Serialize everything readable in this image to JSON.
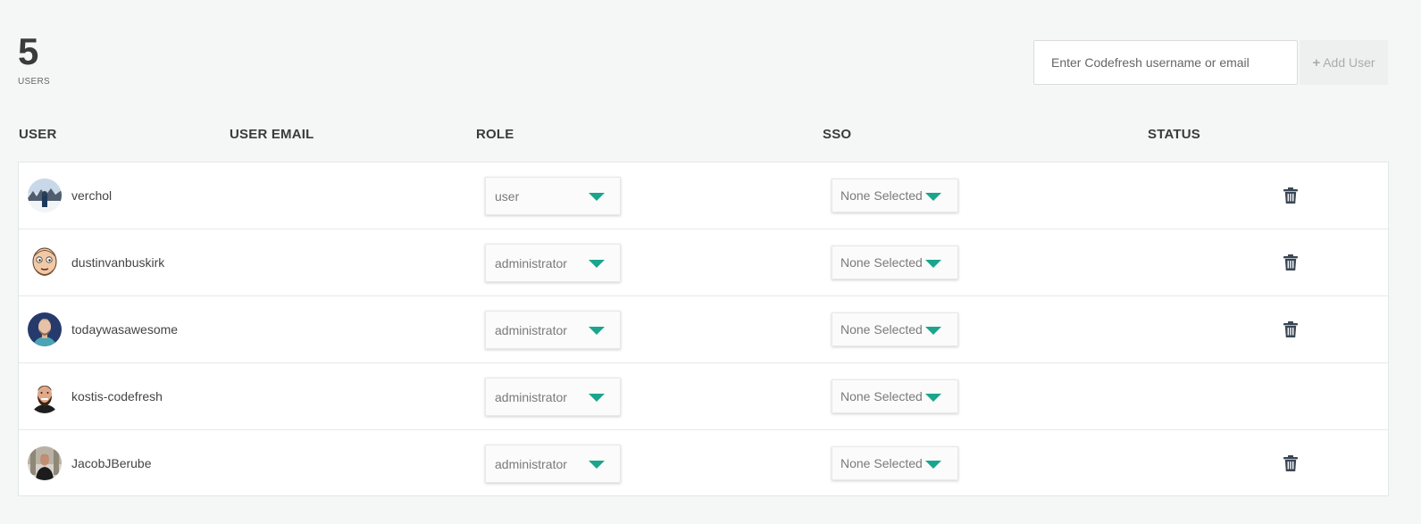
{
  "header": {
    "user_count": "5",
    "user_count_label": "USERS"
  },
  "add_user": {
    "placeholder": "Enter Codefresh username or email",
    "button_label": "Add User",
    "button_icon": "plus-icon"
  },
  "columns": {
    "user": "USER",
    "email": "USER EMAIL",
    "role": "ROLE",
    "sso": "SSO",
    "status": "STATUS"
  },
  "users": [
    {
      "username": "verchol",
      "email": "",
      "role": "user",
      "sso": "None Selected",
      "deletable": true,
      "avatar": "photo-snow-landscape"
    },
    {
      "username": "dustinvanbuskirk",
      "email": "",
      "role": "administrator",
      "sso": "None Selected",
      "deletable": true,
      "avatar": "cartoon-bearded-man"
    },
    {
      "username": "todaywasawesome",
      "email": "",
      "role": "administrator",
      "sso": "None Selected",
      "deletable": true,
      "avatar": "illustrated-man-navy"
    },
    {
      "username": "kostis-codefresh",
      "email": "",
      "role": "administrator",
      "sso": "None Selected",
      "deletable": false,
      "avatar": "cartoon-bearded-man-dark"
    },
    {
      "username": "JacobJBerube",
      "email": "",
      "role": "administrator",
      "sso": "None Selected",
      "deletable": true,
      "avatar": "photo-man-standing"
    }
  ],
  "colors": {
    "accent": "#1aa58c",
    "background": "#f5f7f6",
    "trash": "#3a4655"
  }
}
